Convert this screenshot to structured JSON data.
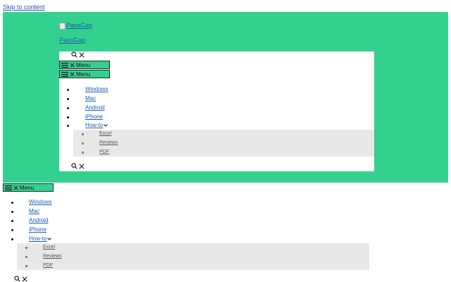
{
  "skip_link": "Skip to content",
  "logo": {
    "alt": "PassGap",
    "icon": "broken-image-icon"
  },
  "site_title": "PassGap",
  "menu_label": "Menu",
  "nav": {
    "items": [
      {
        "label": "Windows"
      },
      {
        "label": "Mac"
      },
      {
        "label": "Android"
      },
      {
        "label": "iPhone"
      },
      {
        "label": "How-to",
        "has_submenu": true
      }
    ],
    "submenu": [
      {
        "label": "Excel"
      },
      {
        "label": "Reviews"
      },
      {
        "label": "PDF"
      }
    ]
  },
  "colors": {
    "header_bg": "#34d08f",
    "submenu_bg": "#e8e8e8",
    "link": "#1a5fa8"
  },
  "icons": [
    "search-icon",
    "close-icon",
    "hamburger-icon",
    "chevron-down-icon"
  ]
}
